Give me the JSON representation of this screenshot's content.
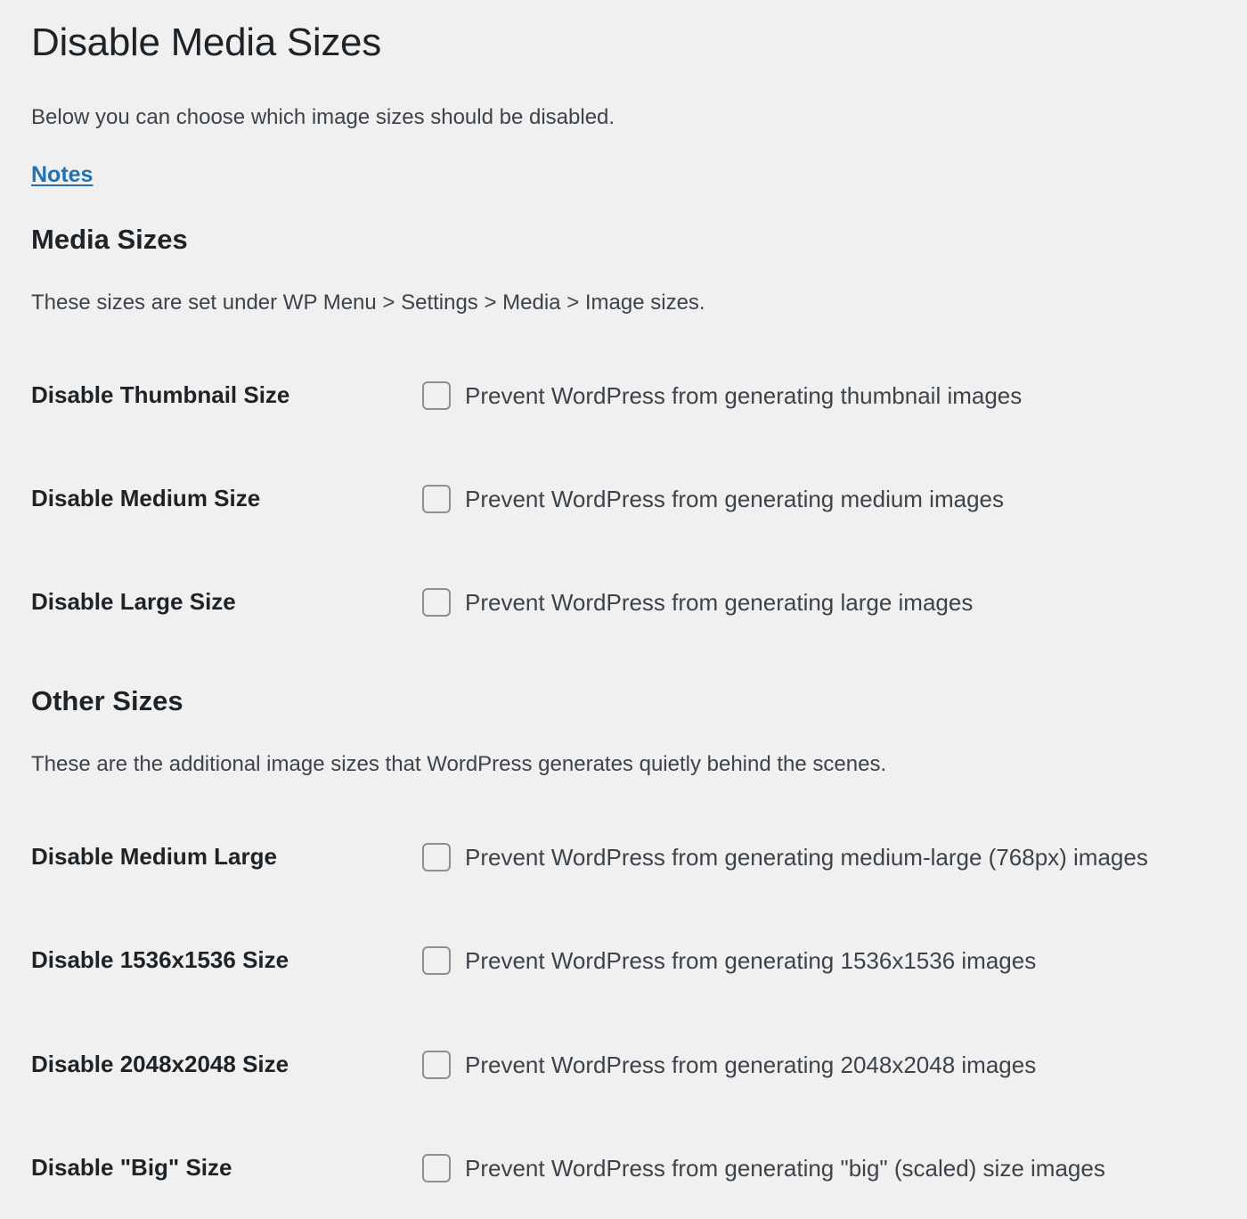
{
  "page": {
    "title": "Disable Media Sizes",
    "intro": "Below you can choose which image sizes should be disabled.",
    "notes_link": "Notes"
  },
  "sections": [
    {
      "title": "Media Sizes",
      "description": "These sizes are set under WP Menu > Settings > Media > Image sizes.",
      "rows": [
        {
          "label": "Disable Thumbnail Size",
          "field_text": "Prevent WordPress from generating thumbnail images",
          "checked": false
        },
        {
          "label": "Disable Medium Size",
          "field_text": "Prevent WordPress from generating medium images",
          "checked": false
        },
        {
          "label": "Disable Large Size",
          "field_text": "Prevent WordPress from generating large images",
          "checked": false
        }
      ]
    },
    {
      "title": "Other Sizes",
      "description": "These are the additional image sizes that WordPress generates quietly behind the scenes.",
      "rows": [
        {
          "label": "Disable Medium Large",
          "field_text": "Prevent WordPress from generating medium-large (768px) images",
          "checked": false
        },
        {
          "label": "Disable 1536x1536 Size",
          "field_text": "Prevent WordPress from generating 1536x1536 images",
          "checked": false
        },
        {
          "label": "Disable 2048x2048 Size",
          "field_text": "Prevent WordPress from generating 2048x2048 images",
          "checked": false
        },
        {
          "label": "Disable \"Big\" Size",
          "field_text": "Prevent WordPress from generating \"big\" (scaled) size images",
          "checked": false
        }
      ]
    }
  ],
  "colors": {
    "background": "#f0f0f1",
    "heading": "#1d2327",
    "text": "#3c434a",
    "link": "#2271b1",
    "checkbox_border": "#8c8f94"
  }
}
